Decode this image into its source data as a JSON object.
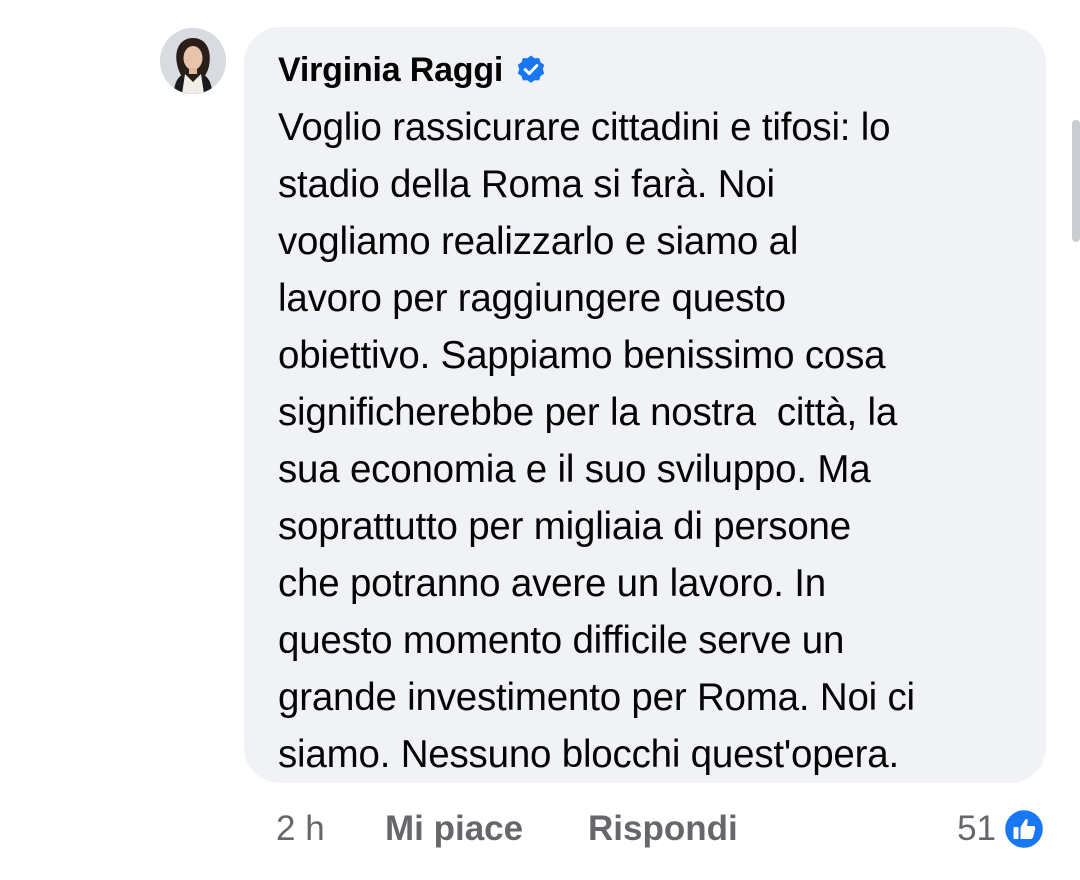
{
  "comment": {
    "author": "Virginia Raggi",
    "verified": true,
    "text": "Voglio rassicurare cittadini e tifosi: lo\nstadio della Roma si farà. Noi\nvogliamo realizzarlo e siamo al\nlavoro per raggiungere questo\nobiettivo. Sappiamo benissimo cosa\nsignificherebbe per la nostra  città, la\nsua economia e il suo sviluppo. Ma\nsoprattutto per migliaia di persone\nche potranno avere un lavoro. In\nquesto momento difficile serve un\ngrande investimento per Roma. Noi ci\nsiamo. Nessuno blocchi quest'opera."
  },
  "actions": {
    "time": "2 h",
    "like_label": "Mi piace",
    "reply_label": "Rispondi"
  },
  "reactions": {
    "count": "51",
    "icon": "like-icon"
  },
  "colors": {
    "bubble_bg": "#f0f2f5",
    "verified_blue": "#1877f2",
    "secondary_text": "#65676b"
  }
}
